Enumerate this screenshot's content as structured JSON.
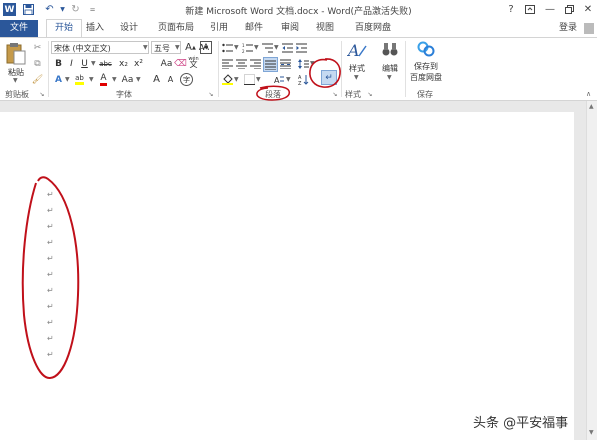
{
  "window": {
    "title": "新建 Microsoft Word 文档.docx - Word(产品激活失败)",
    "help_icon": "?",
    "login": "登录"
  },
  "tabs": [
    "文件",
    "开始",
    "插入",
    "设计",
    "页面布局",
    "引用",
    "邮件",
    "审阅",
    "视图",
    "百度网盘"
  ],
  "ribbon": {
    "clipboard": {
      "label": "剪贴板",
      "paste": "粘贴"
    },
    "font": {
      "label": "字体",
      "font_name": "宋体 (中文正文)",
      "font_size": "五号",
      "grow": "A",
      "shrink": "A",
      "aa": "Aa",
      "wen": "wén",
      "wen_char": "文",
      "char_border": "A",
      "bold": "B",
      "italic": "I",
      "underline": "U",
      "strike": "abc",
      "subscript": "x₂",
      "superscript": "x²",
      "effect": "A",
      "highlight": "ab",
      "fontcolor": "A",
      "aa2": "Aa",
      "a1": "A",
      "a2": "A",
      "circle_char": "字"
    },
    "paragraph": {
      "label": "段落"
    },
    "styles": {
      "label": "样式",
      "button": "样式"
    },
    "editing": {
      "button": "编辑"
    },
    "save": {
      "label": "保存",
      "button_line1": "保存到",
      "button_line2": "百度网盘"
    }
  },
  "document": {
    "paragraph_marks": [
      "↵",
      "↵",
      "↵",
      "↵",
      "↵",
      "↵",
      "↵",
      "↵",
      "↵",
      "↵",
      "↵"
    ]
  },
  "watermark": "头条 @平安福事",
  "colors": {
    "accent": "#2b579a",
    "annotation": "#c0101a"
  }
}
